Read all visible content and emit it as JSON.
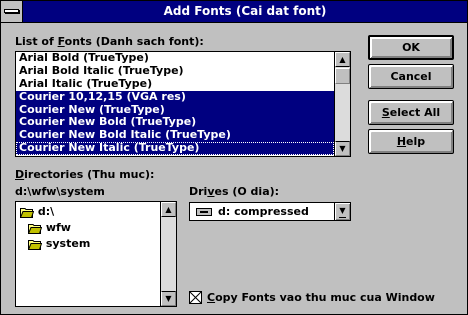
{
  "window": {
    "title": "Add Fonts (Cai dat font)"
  },
  "fonts_list": {
    "label_before": "List of ",
    "label_underlined": "F",
    "label_after": "onts (Danh sach font):",
    "items": [
      {
        "label": "Arial Bold (TrueType)",
        "selected": false
      },
      {
        "label": "Arial Bold Italic (TrueType)",
        "selected": false
      },
      {
        "label": "Arial Italic (TrueType)",
        "selected": false
      },
      {
        "label": "Courier 10,12,15 (VGA res)",
        "selected": true
      },
      {
        "label": "Courier New (TrueType)",
        "selected": true
      },
      {
        "label": "Courier New Bold (TrueType)",
        "selected": true
      },
      {
        "label": "Courier New Bold Italic (TrueType)",
        "selected": true
      },
      {
        "label": "Courier New Italic (TrueType)",
        "selected": true
      }
    ]
  },
  "buttons": {
    "ok": "OK",
    "cancel": "Cancel",
    "select_all_underlined": "S",
    "select_all_rest": "elect All",
    "help_underlined": "H",
    "help_rest": "elp"
  },
  "directories": {
    "label_underlined": "D",
    "label_rest": "irectories (Thu muc):",
    "current_path": "d:\\wfw\\system",
    "tree": [
      {
        "label": "d:\\",
        "indent": 0,
        "open": true
      },
      {
        "label": "wfw",
        "indent": 1,
        "open": true
      },
      {
        "label": "system",
        "indent": 2,
        "open": true
      }
    ]
  },
  "drives": {
    "label_before": "Dri",
    "label_underlined": "v",
    "label_after": "es (O dia):",
    "selected": "d: compressed"
  },
  "copy_option": {
    "checked": true,
    "label_underlined": "C",
    "label_rest": "opy Fonts vao thu muc cua Window"
  },
  "colors": {
    "title_bar": "#000080",
    "selection": "#000080",
    "face": "#c0c0c0"
  }
}
